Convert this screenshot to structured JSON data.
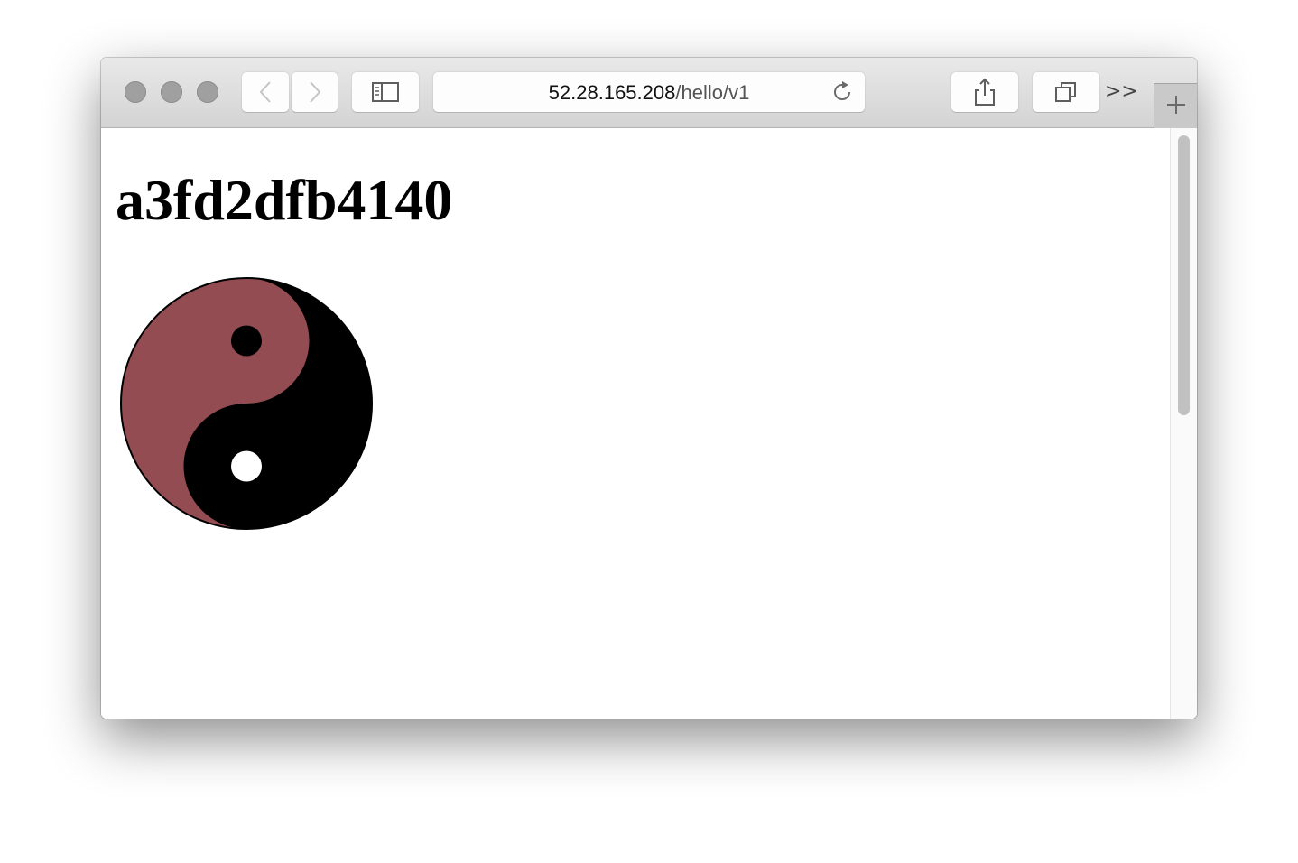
{
  "browser": {
    "url_host": "52.28.165.208",
    "url_path": "/hello/v1",
    "overflow_label": ">>",
    "icons": {
      "back": "chevron-left-icon",
      "forward": "chevron-right-icon",
      "sidebar": "sidebar-icon",
      "reload": "reload-icon",
      "share": "share-icon",
      "tabs": "tab-overview-icon",
      "new_tab": "plus-icon"
    }
  },
  "page": {
    "heading": "a3fd2dfb4140",
    "yinyang_colors": {
      "light": "#924c52",
      "dark": "#000000",
      "dot_light": "#ffffff",
      "dot_dark": "#000000"
    }
  }
}
